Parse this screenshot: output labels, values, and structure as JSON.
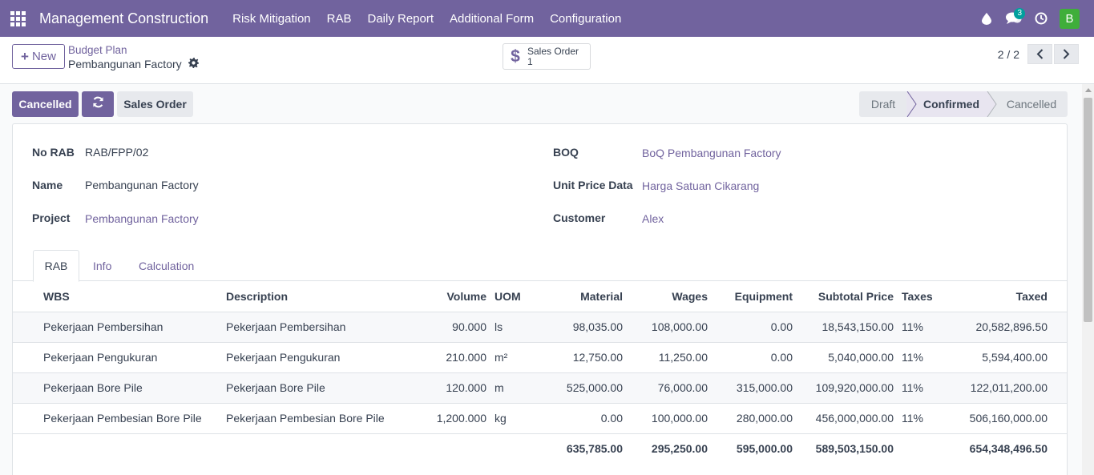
{
  "topnav": {
    "brand": "Management Construction",
    "menu": [
      "Risk Mitigation",
      "RAB",
      "Daily Report",
      "Additional Form",
      "Configuration"
    ],
    "messages_count": "3",
    "avatar_initial": "B",
    "avatar_color": "#3fae3a",
    "icons": [
      "apps-icon",
      "drop-icon",
      "chat-icon",
      "clock-icon"
    ]
  },
  "control": {
    "new_label": "New",
    "breadcrumb_parent": "Budget Plan",
    "breadcrumb_current": "Pembangunan Factory",
    "smart_button": {
      "label": "Sales Order",
      "value": "1"
    },
    "pager": "2 / 2"
  },
  "status": {
    "buttons": {
      "cancelled": "Cancelled",
      "sales_order": "Sales Order"
    },
    "stages": [
      "Draft",
      "Confirmed",
      "Cancelled"
    ],
    "active_stage": "Confirmed"
  },
  "form": {
    "left": [
      {
        "label": "No RAB",
        "value": "RAB/FPP/02",
        "link": false
      },
      {
        "label": "Name",
        "value": "Pembangunan Factory",
        "link": false
      },
      {
        "label": "Project",
        "value": "Pembangunan Factory",
        "link": true
      }
    ],
    "right": [
      {
        "label": "BOQ",
        "value": "BoQ Pembangunan Factory",
        "link": true
      },
      {
        "label": "Unit Price Data",
        "value": "Harga Satuan Cikarang",
        "link": true
      },
      {
        "label": "Customer",
        "value": "Alex",
        "link": true
      }
    ]
  },
  "tabs": [
    "RAB",
    "Info",
    "Calculation"
  ],
  "table": {
    "headers": [
      "WBS",
      "Description",
      "Volume",
      "UOM",
      "Material",
      "Wages",
      "Equipment",
      "Subtotal Price",
      "Taxes",
      "Taxed"
    ],
    "rows": [
      [
        "Pekerjaan Pembersihan",
        "Pekerjaan Pembersihan",
        "90.000",
        "ls",
        "98,035.00",
        "108,000.00",
        "0.00",
        "18,543,150.00",
        "11%",
        "20,582,896.50"
      ],
      [
        "Pekerjaan Pengukuran",
        "Pekerjaan Pengukuran",
        "210.000",
        "m²",
        "12,750.00",
        "11,250.00",
        "0.00",
        "5,040,000.00",
        "11%",
        "5,594,400.00"
      ],
      [
        "Pekerjaan Bore Pile",
        "Pekerjaan Bore Pile",
        "120.000",
        "m",
        "525,000.00",
        "76,000.00",
        "315,000.00",
        "109,920,000.00",
        "11%",
        "122,011,200.00"
      ],
      [
        "Pekerjaan Pembesian Bore Pile",
        "Pekerjaan Pembesian Bore Pile",
        "1,200.000",
        "kg",
        "0.00",
        "100,000.00",
        "280,000.00",
        "456,000,000.00",
        "11%",
        "506,160,000.00"
      ]
    ],
    "totals": {
      "material": "635,785.00",
      "wages": "295,250.00",
      "equipment": "595,000.00",
      "subtotal": "589,503,150.00",
      "taxed": "654,348,496.50"
    }
  },
  "colors": {
    "brand": "#71639e",
    "accent_badge": "#00a09d"
  }
}
